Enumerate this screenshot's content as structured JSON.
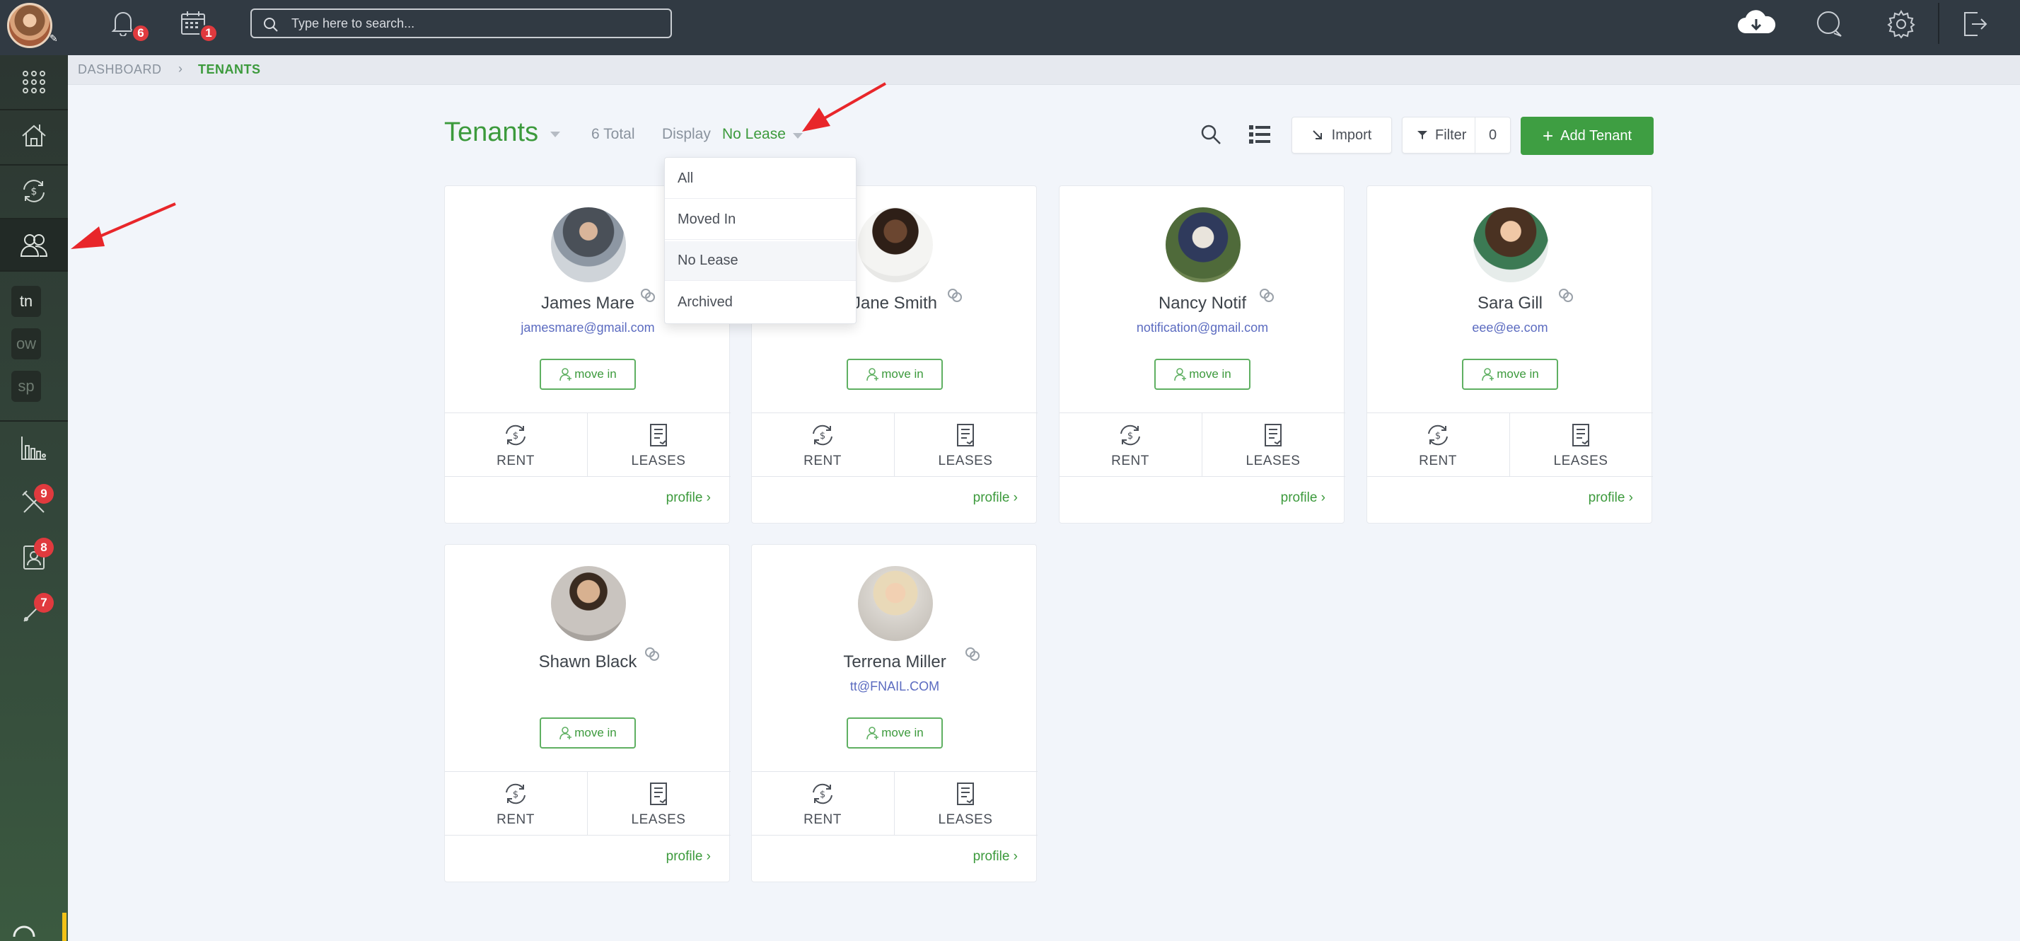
{
  "topbar": {
    "notifications_count": "6",
    "calendar_count": "1",
    "search_placeholder": "Type here to search..."
  },
  "sidebar": {
    "text_items": [
      "tn",
      "ow",
      "sp"
    ],
    "maintenance_count": "9",
    "applications_count": "8",
    "tools_count": "7"
  },
  "breadcrumb": {
    "dashboard": "DASHBOARD",
    "current": "TENANTS"
  },
  "header": {
    "title": "Tenants",
    "total": "6 Total",
    "display_label": "Display",
    "display_value": "No Lease",
    "import_label": "Import",
    "filter_label": "Filter",
    "filter_count": "0",
    "add_label": "Add Tenant"
  },
  "dropdown": {
    "options": [
      "All",
      "Moved In",
      "No Lease",
      "Archived"
    ],
    "highlighted": "No Lease"
  },
  "card_labels": {
    "move_in": "move in",
    "rent": "RENT",
    "leases": "LEASES",
    "profile": "profile"
  },
  "tenants": [
    {
      "name": "James Mare",
      "email": "jamesmare@gmail.com"
    },
    {
      "name": "Jane Smith",
      "email": ""
    },
    {
      "name": "Nancy Notif",
      "email": "notification@gmail.com"
    },
    {
      "name": "Sara Gill",
      "email": "eee@ee.com"
    },
    {
      "name": "Shawn Black",
      "email": ""
    },
    {
      "name": "Terrena Miller",
      "email": "tt@FNAIL.COM"
    }
  ],
  "colors": {
    "accent_green": "#3c9a3c",
    "button_green": "#3e9e42",
    "topbar": "#313a43",
    "badge_red": "#e03a3e",
    "email_blue": "#5b6bc0",
    "annotation_arrow": "#e8262a"
  }
}
